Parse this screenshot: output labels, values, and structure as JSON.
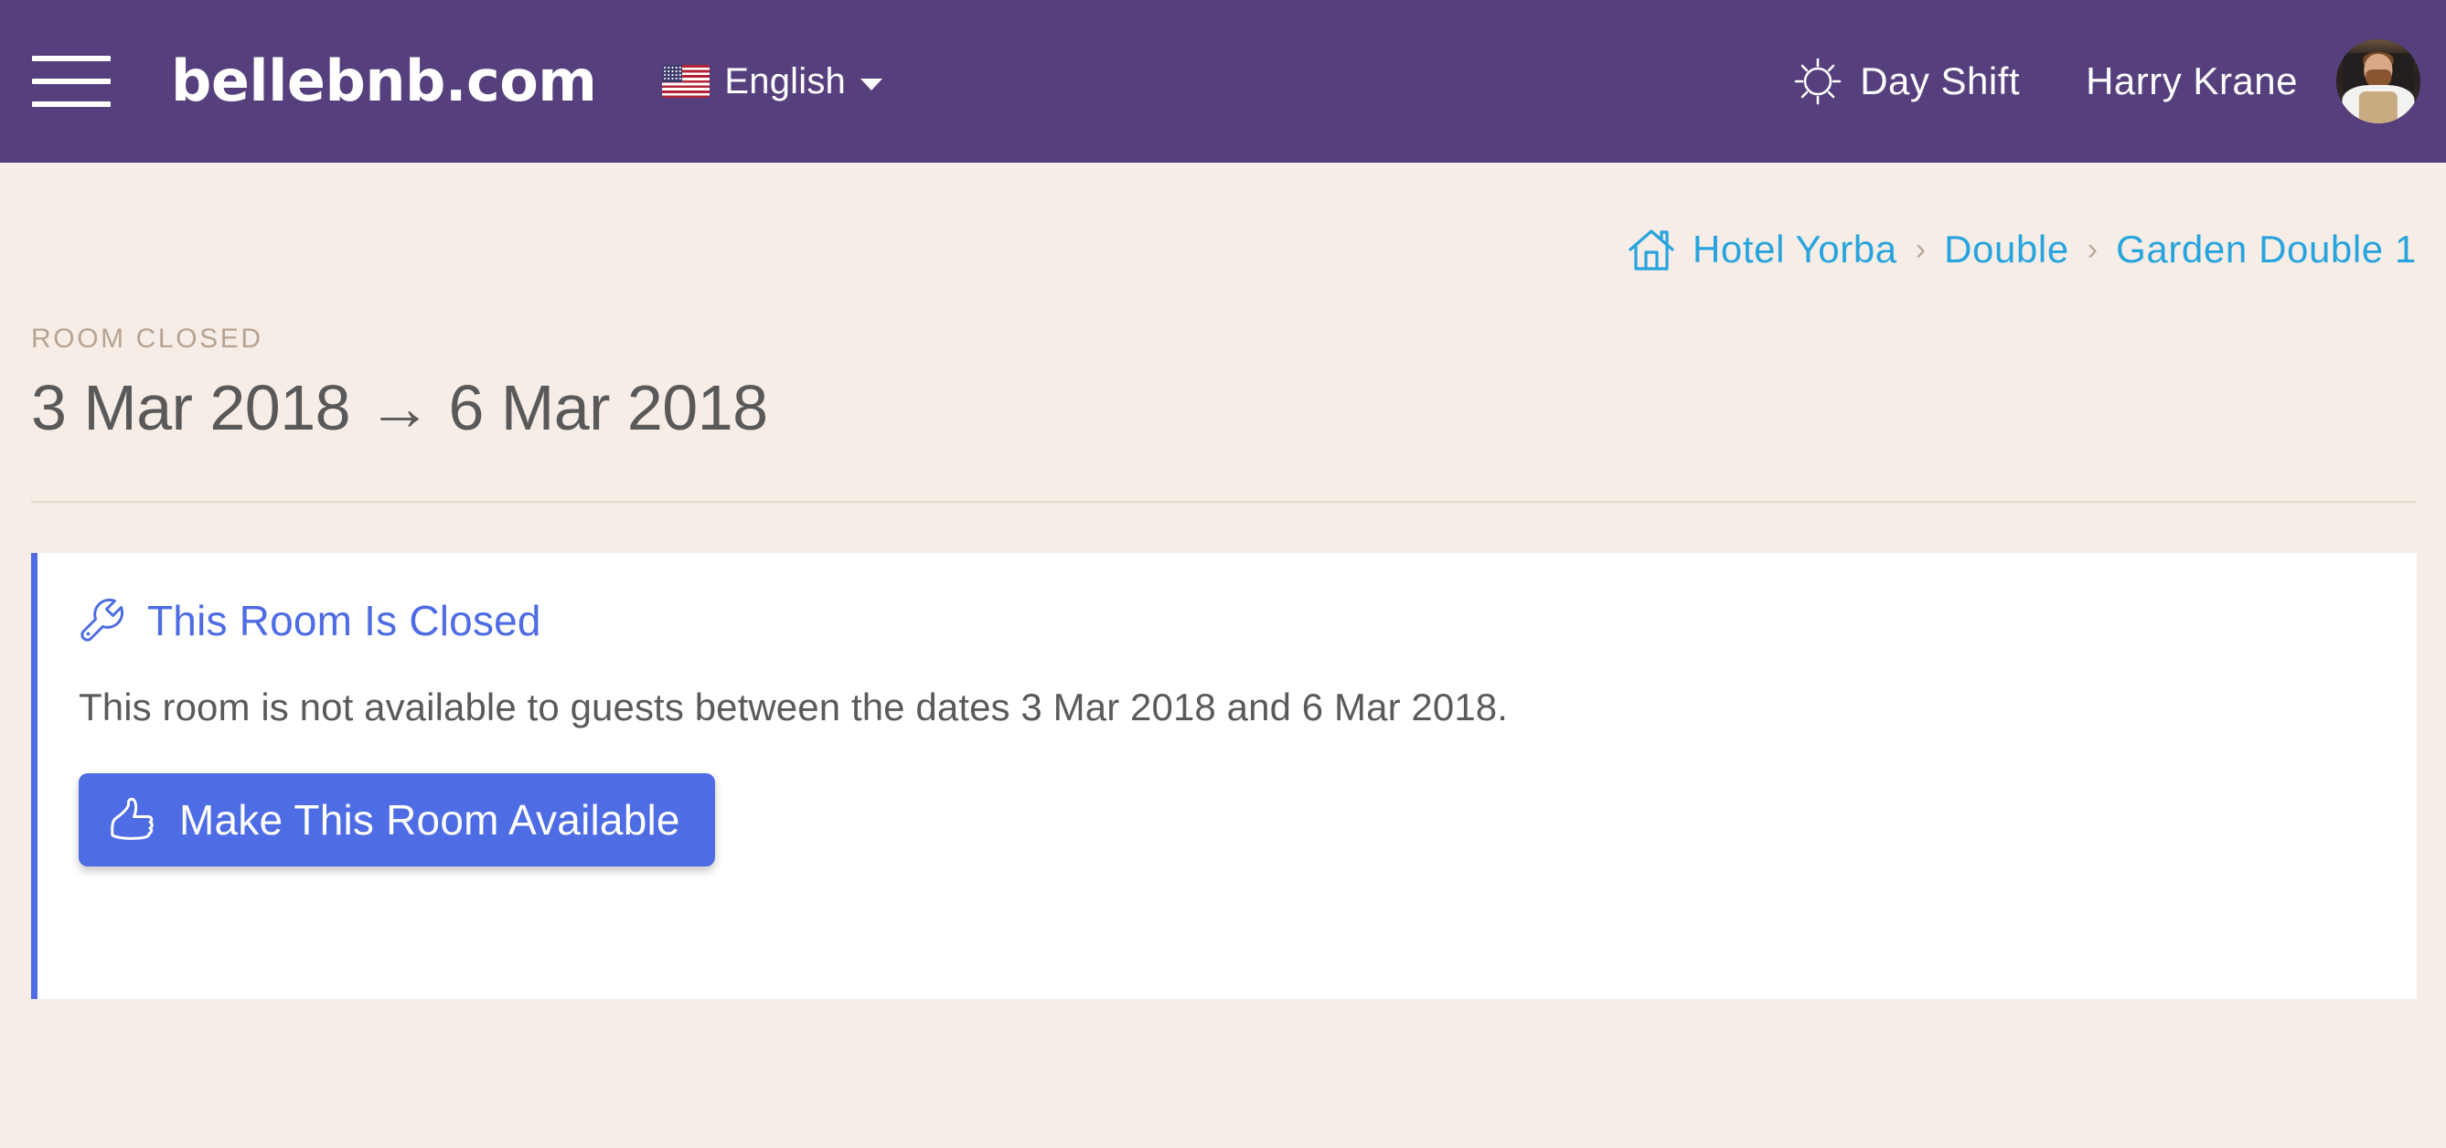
{
  "theme": {
    "header_bg": "#55407D",
    "page_bg": "#F6EDE7",
    "accent_blue": "#4E6CE3",
    "link_blue": "#27A4DD",
    "eyebrow_tan": "#B7A391",
    "text_gray": "#595959"
  },
  "header": {
    "menu_icon": "hamburger-icon",
    "brand": "bellebnb.com",
    "language": {
      "flag_icon": "us-flag-icon",
      "label": "English",
      "caret_icon": "chevron-down-icon"
    },
    "shift": {
      "icon": "sun-icon",
      "label": "Day Shift"
    },
    "user": {
      "name": "Harry Krane",
      "avatar_icon": "user-avatar"
    }
  },
  "breadcrumb": {
    "home_icon": "home-icon",
    "separator": "›",
    "items": [
      {
        "label": "Hotel Yorba"
      },
      {
        "label": "Double"
      },
      {
        "label": "Garden Double 1"
      }
    ]
  },
  "main": {
    "eyebrow": "ROOM CLOSED",
    "title": "3 Mar 2018 → 6 Mar 2018",
    "start_date": "3 Mar 2018",
    "end_date": "6 Mar 2018"
  },
  "alert": {
    "icon": "wrench-icon",
    "title": "This Room Is Closed",
    "body": "This room is not available to guests between the dates 3 Mar 2018 and 6 Mar 2018.",
    "action": {
      "icon": "thumbs-up-icon",
      "label": "Make This Room Available"
    }
  }
}
